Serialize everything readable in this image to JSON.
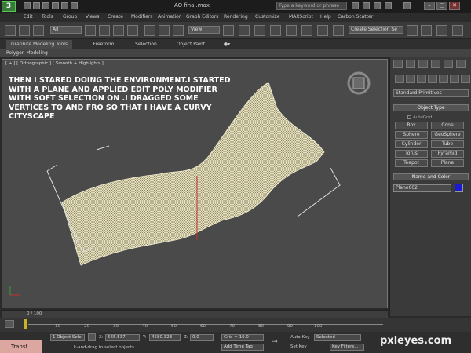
{
  "titlebar": {
    "logo": "3",
    "title": "AO final.max",
    "search_placeholder": "Type a keyword or phrase"
  },
  "menu": [
    "Edit",
    "Tools",
    "Group",
    "Views",
    "Create",
    "Modifiers",
    "Animation",
    "Graph Editors",
    "Rendering",
    "Customize",
    "MAXScript",
    "Help",
    "Carbon Scatter"
  ],
  "toolbar": {
    "filter_value": "All",
    "view_value": "View",
    "selection_set_placeholder": "Create Selection Se"
  },
  "tabs": [
    "Graphite Modeling Tools",
    "Freeform",
    "Selection",
    "Object Paint"
  ],
  "subtab": "Polygon Modeling",
  "viewport": {
    "label": "[ + ] [ Orthographic ] [ Smooth + Highlights ]",
    "overlay_lines": [
      "THEN I STARED DOING THE ENVIRONMENT.I STARTED",
      "WITH A PLANE AND APPLIED EDIT POLY MODIFIER",
      "WITH SOFT SELECTION ON .I DRAGGED SOME",
      "VERTICES TO AND FRO SO THAT I HAVE A CURVY",
      "CITYSCAPE"
    ]
  },
  "command_panel": {
    "category": "Standard Primitives",
    "object_type_title": "Object Type",
    "autogrid": "AutoGrid",
    "buttons": [
      "Box",
      "Cone",
      "Sphere",
      "GeoSphere",
      "Cylinder",
      "Tube",
      "Torus",
      "Pyramid",
      "Teapot",
      "Plane"
    ],
    "name_color_title": "Name and Color",
    "object_name": "Plane002",
    "object_color": "#1a1ad0"
  },
  "time_slider": {
    "label": "0 / 100"
  },
  "ticks": [
    "10",
    "20",
    "30",
    "40",
    "50",
    "60",
    "70",
    "80",
    "90",
    "100"
  ],
  "status": {
    "selection": "1 Object Sele",
    "x_label": "X:",
    "x": "565.537",
    "y_label": "Y:",
    "y": "4580.323",
    "z_label": "Z:",
    "z": "0.0",
    "grid": "Grid = 10.0",
    "hint": "k-and-drag to select objects",
    "add_time_tag": "Add Time Tag",
    "auto_key": "Auto Key",
    "auto_key_value": "Selected",
    "set_key": "Set Key",
    "key_filters": "Key Filters...",
    "taskbar": "Transf..."
  },
  "watermark": "pxleyes.com"
}
